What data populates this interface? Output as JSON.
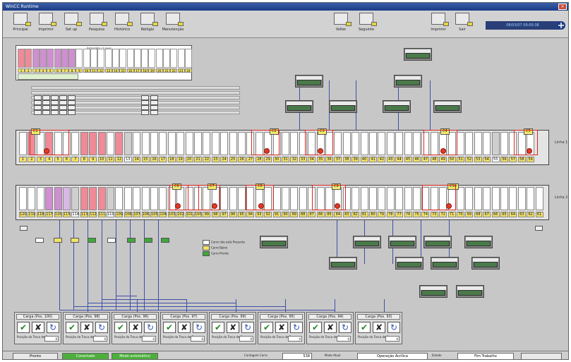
{
  "window": {
    "title": "WinCC Runtime",
    "close_glyph": "×"
  },
  "toolbar": {
    "items": [
      {
        "label": "Principal",
        "icon": "home-icon"
      },
      {
        "label": "Imprimir",
        "icon": "printer-icon"
      },
      {
        "label": "Set up",
        "icon": "setup-icon"
      },
      {
        "label": "Pesquisa",
        "icon": "search-icon"
      },
      {
        "label": "Histórico",
        "icon": "chart-icon"
      },
      {
        "label": "Relógio",
        "icon": "clock-icon"
      },
      {
        "label": "Manutenção",
        "icon": "wrench-icon"
      },
      {
        "label": "Voltar",
        "icon": "arrow-left-icon"
      },
      {
        "label": "Seguinte",
        "icon": "arrow-right-icon"
      },
      {
        "label": "Imprimir",
        "icon": "printer-icon"
      },
      {
        "label": "Sair",
        "icon": "exit-icon"
      }
    ],
    "clock": "08/03/07 09:00:38"
  },
  "top_panel": {
    "header": "Armazém / Lanes"
  },
  "line_labels": [
    "Linha 1",
    "Linha 2"
  ],
  "zones": [
    "C1",
    "C2",
    "C3",
    "C4",
    "C5",
    "C6",
    "C7",
    "C8",
    "C9",
    "C10"
  ],
  "legend": [
    {
      "label": "Carro não está Presente",
      "color": "#ffffff"
    },
    {
      "label": "Carro Baixo",
      "color": "#f2e26a"
    },
    {
      "label": "Carro Pronto",
      "color": "#3fa83a"
    }
  ],
  "controls": [
    {
      "title": "Carga (Pos. 100)",
      "prompt": "Posição do Troca de Buzer",
      "value": "0"
    },
    {
      "title": "Carga (Pos. 98)",
      "prompt": "Posição do Troca de Buzer",
      "value": "0"
    },
    {
      "title": "Carga (Pos. 96)",
      "prompt": "Posição do Troca de Buzer",
      "value": "0"
    },
    {
      "title": "Carga (Pos. 97)",
      "prompt": "Posição do Troca de Buzer",
      "value": "0"
    },
    {
      "title": "Carga (Pos. 99)",
      "prompt": "Posição do Troca de Buzer",
      "value": "0"
    },
    {
      "title": "Carga (Pos. 95)",
      "prompt": "Posição do Troca de Buzer",
      "value": "0"
    },
    {
      "title": "Carga (Pos. 94)",
      "prompt": "Posição do Troca de Buzer",
      "value": "0"
    },
    {
      "title": "Carga (Pos. 93)",
      "prompt": "Posição do Troca de Buzer",
      "value": "0"
    }
  ],
  "status": {
    "left": "Pronto",
    "green1": "Conectado",
    "green2": "Modo automático",
    "counter_label": "Contagem Carro",
    "counter_value": "538",
    "mode_label": "Modo Atual",
    "mode_value": "Operação Acrílica",
    "status_label": "Estado",
    "status_value": "Fim Trabalho"
  }
}
